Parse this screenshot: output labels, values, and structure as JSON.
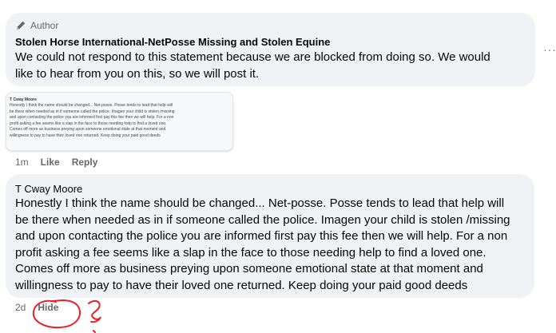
{
  "comment1": {
    "author_badge": "Author",
    "author_name": "Stolen Horse International-NetPosse Missing and Stolen Equine",
    "text_lines": [
      "We could not respond to this statement because we are blocked from doing so. We would",
      "like to hear from you on this, so we will post it."
    ],
    "more_icon": "more-options-icon",
    "attachment": {
      "name": "T Cway Moore",
      "text_lines": [
        "Honestly I think the name should be changed... Net-posse. Posse tends to lead that help will",
        "be there when needed as in if someone called the police. Imagen your child is stolen /missing",
        "and upon contacting the police you are informed first pay this fee then we will help. For a non",
        "profit asking a fee seems like a slap in the face to those needing help to find a loved one.",
        "Comes off more as business preying upon someone emotional state at that moment and",
        "willingness to pay to have their loved one returned. Keep doing your paid good deeds"
      ]
    },
    "time": "1m",
    "like_label": "Like",
    "reply_label": "Reply"
  },
  "comment2": {
    "author_name": "T Cway Moore",
    "text_lines": [
      "Honestly I think the name should be changed... Net-posse. Posse tends to lead that help will",
      "be there when needed as in if someone called the police. Imagen your child is stolen /missing",
      "and upon contacting the police you are informed first pay this fee then we will help. For a non",
      "profit asking a fee seems like a slap in the face to those needing help to find a loved one.",
      "Comes off more as business preying upon someone emotional state at that moment and",
      "willingness to pay to have their loved one returned. Keep doing your paid good deeds"
    ],
    "time": "2d",
    "hide_label": "Hide"
  },
  "colors": {
    "bubble": "#f0f2f5",
    "secondary_text": "#65676b",
    "annotation_red": "#e8212a"
  }
}
